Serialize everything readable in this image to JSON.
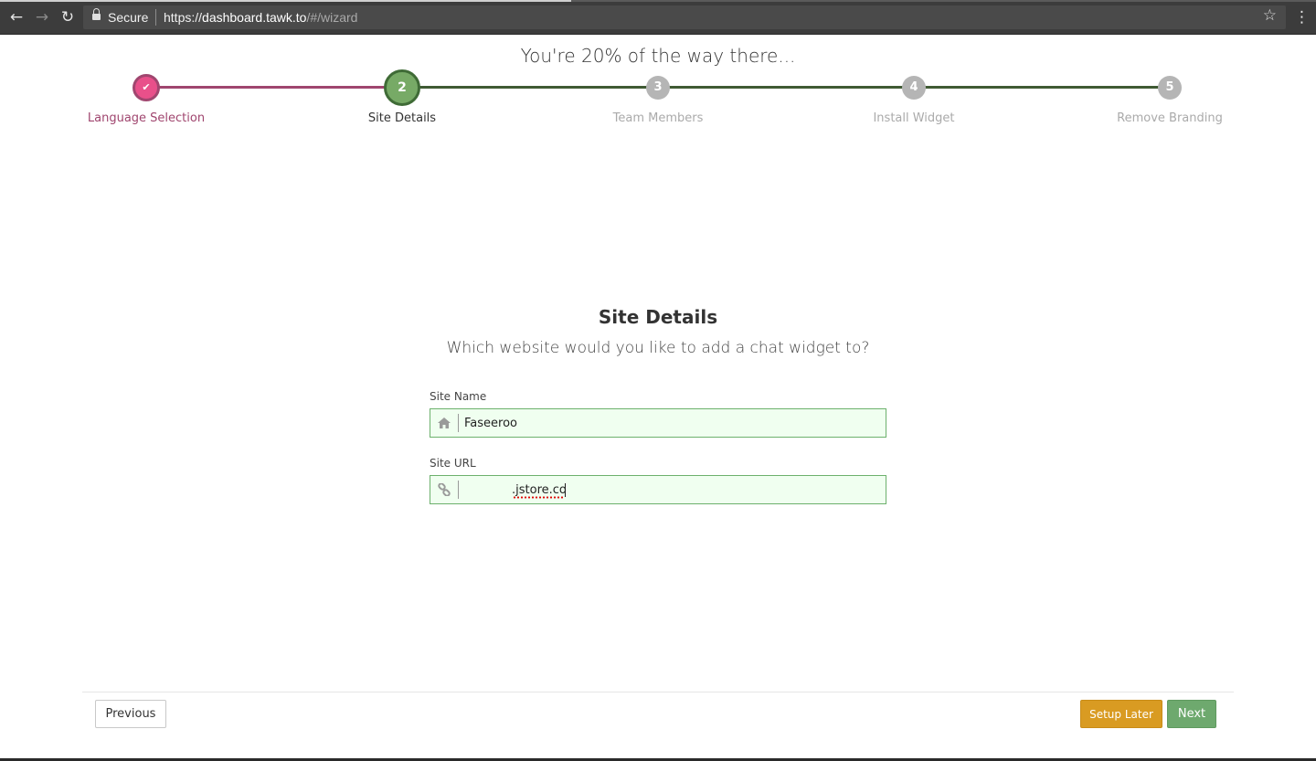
{
  "browser": {
    "secure_label": "Secure",
    "url_scheme": "https://",
    "url_host": "dashboard.tawk.to",
    "url_path": "/#/wizard",
    "icons": [
      "back-arrow-icon",
      "forward-arrow-icon",
      "reload-icon",
      "lock-icon",
      "star-icon",
      "menu-dots-icon"
    ]
  },
  "wizard": {
    "progress_text": "You're 20% of the way there...",
    "progress_percent": 20,
    "steps": [
      {
        "number": "",
        "label": "Language Selection",
        "state": "completed"
      },
      {
        "number": "2",
        "label": "Site Details",
        "state": "active"
      },
      {
        "number": "3",
        "label": "Team Members",
        "state": "pending"
      },
      {
        "number": "4",
        "label": "Install Widget",
        "state": "pending"
      },
      {
        "number": "5",
        "label": "Remove Branding",
        "state": "pending"
      }
    ],
    "colors": {
      "completed": "#e8508a",
      "completed_text": "#a0466f",
      "active": "#77aa66",
      "active_border": "#3f6b36",
      "pending": "#b5b5b5",
      "pending_text": "#aaaaaa",
      "line_done": "#a0466f",
      "line_todo": "#3f5a33"
    }
  },
  "form": {
    "title": "Site Details",
    "subtitle": "Which website would you like to add a chat widget to?",
    "site_name": {
      "label": "Site Name",
      "value": "Faseeroo",
      "icon": "home-icon"
    },
    "site_url": {
      "label": "Site URL",
      "value": ".jstore.co",
      "icon": "link-icon"
    }
  },
  "footer": {
    "previous_label": "Previous",
    "setup_later_label": "Setup Later",
    "next_label": "Next"
  }
}
